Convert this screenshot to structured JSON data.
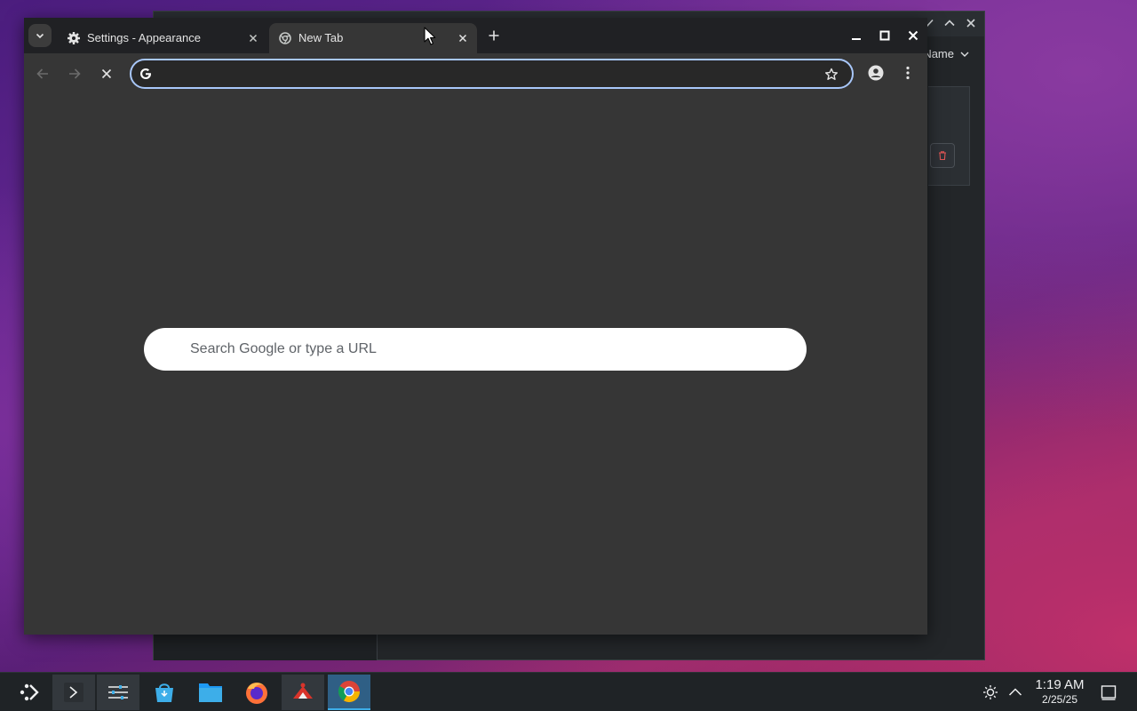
{
  "browser": {
    "tabs": [
      {
        "title": "Settings - Appearance",
        "favicon": "gear-icon",
        "active": false
      },
      {
        "title": "New Tab",
        "favicon": "chrome-loading-icon",
        "active": true
      }
    ],
    "omnibox": {
      "value": "",
      "placeholder": ""
    },
    "ntp_search_placeholder": "Search Google or type a URL"
  },
  "background_window": {
    "sort_label": "Name"
  },
  "taskbar": {
    "apps": [
      "launcher-icon",
      "terminal-icon",
      "settings-icon",
      "discover-store-icon",
      "file-manager-icon",
      "firefox-icon",
      "game-app-icon",
      "chrome-icon"
    ],
    "time": "1:19 AM",
    "date": "2/25/25"
  },
  "colors": {
    "accent": "#a8c7fa",
    "taskbar_active": "#2f5f85",
    "browser_bg": "#363636",
    "tabstrip_bg": "#202124"
  }
}
